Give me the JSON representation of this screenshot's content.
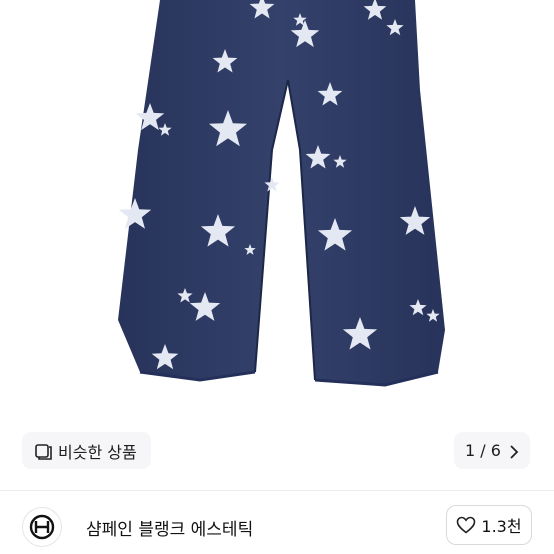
{
  "photo": {
    "subject": "navy denim wide-leg pants with white star print",
    "colors": {
      "denim": "#2f3b63",
      "star": "#e4e8f2",
      "background": "#ffffff"
    }
  },
  "gallery": {
    "similar_label": "비슷한 상품",
    "similar_icon": "similar-products-icon",
    "counter": "1 / 6",
    "next_icon": "chevron-right-icon"
  },
  "shop": {
    "name": "샴페인 블랭크 에스테틱",
    "logo_icon": "shop-logo-monogram",
    "likes": "1.3천",
    "like_icon": "heart-outline-icon"
  }
}
